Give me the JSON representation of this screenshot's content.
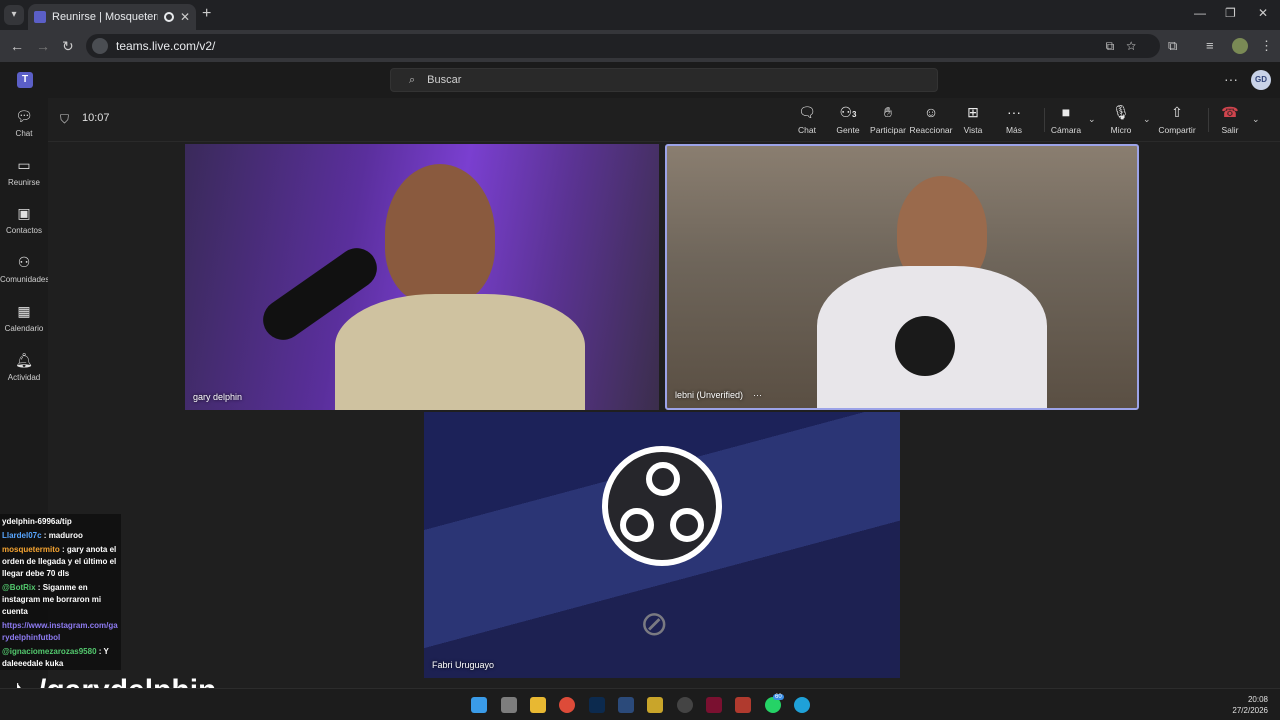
{
  "browser": {
    "tab_title": "Reunirse | Mosquetermos | M",
    "url": "teams.live.com/v2/"
  },
  "teams": {
    "search_placeholder": "Buscar",
    "avatar_initials": "GD",
    "rail": [
      {
        "label": "Chat",
        "icon": "chat-icon"
      },
      {
        "label": "Reunirse",
        "icon": "video-icon"
      },
      {
        "label": "Contactos",
        "icon": "contacts-icon"
      },
      {
        "label": "Comunidades",
        "icon": "communities-icon"
      },
      {
        "label": "Calendario",
        "icon": "calendar-icon"
      },
      {
        "label": "Actividad",
        "icon": "bell-icon"
      }
    ]
  },
  "meeting": {
    "timer": "10:07",
    "controls": {
      "chat": "Chat",
      "people": "Gente",
      "people_count": "3",
      "raise": "Participar",
      "react": "Reaccionar",
      "view": "Vista",
      "more": "Más",
      "camera": "Cámara",
      "mic": "Micro",
      "share": "Compartir",
      "leave": "Salir"
    },
    "participants": [
      {
        "name": "gary delphin"
      },
      {
        "name": "lebni (Unverified)",
        "more": "···"
      },
      {
        "name": "Fabri Uruguayo"
      }
    ]
  },
  "overlay_chat": [
    {
      "user": "",
      "text": "ydelphin-6996a/tip"
    },
    {
      "user": "Llardel07c",
      "text": " : maduroo"
    },
    {
      "user": "mosquetermito",
      "text": " : gary anota el orden de llegada y el último el llegar debe 70 dls"
    },
    {
      "user": "@BotRix",
      "text": " : Siganme en instagram me borraron mi cuenta"
    },
    {
      "user": "",
      "text": "https://www.instagram.com/garydelphinfutbol"
    },
    {
      "user": "@ignaciomezarozas9580",
      "text": " : Y daleeedale kuka"
    }
  ],
  "brand": {
    "handle": "/garydelphin"
  },
  "taskbar": {
    "time": "20:08",
    "date": "27/2/2026",
    "badge": "60"
  },
  "colors": {
    "accent": "#5b5fc7",
    "leave": "#d0444d",
    "active_border": "#9ca3e8"
  }
}
